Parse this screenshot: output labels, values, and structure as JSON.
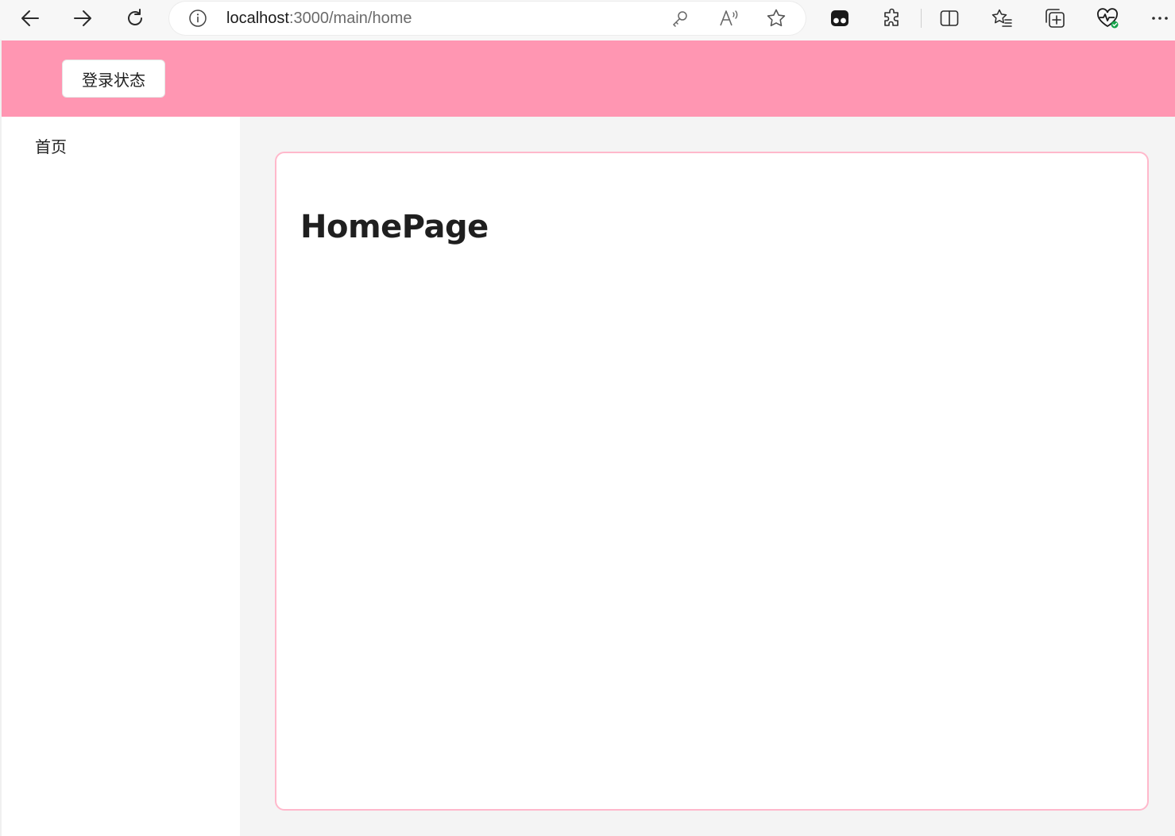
{
  "browser": {
    "url_host": "localhost",
    "url_path": ":3000/main/home",
    "icons": [
      "back-icon",
      "forward-icon",
      "refresh-icon",
      "info-icon",
      "key-icon",
      "read-aloud-icon",
      "favorite-star-icon",
      "extension-app-icon",
      "extensions-puzzle-icon",
      "split-screen-icon",
      "favorites-list-icon",
      "collections-icon",
      "browser-health-icon",
      "more-options-icon"
    ]
  },
  "header": {
    "login_status_label": "登录状态",
    "background": "#ff96b2"
  },
  "sidebar": {
    "items": [
      {
        "label": "首页"
      }
    ]
  },
  "main": {
    "title": "HomePage",
    "card_border_color": "#ffb8cb"
  }
}
